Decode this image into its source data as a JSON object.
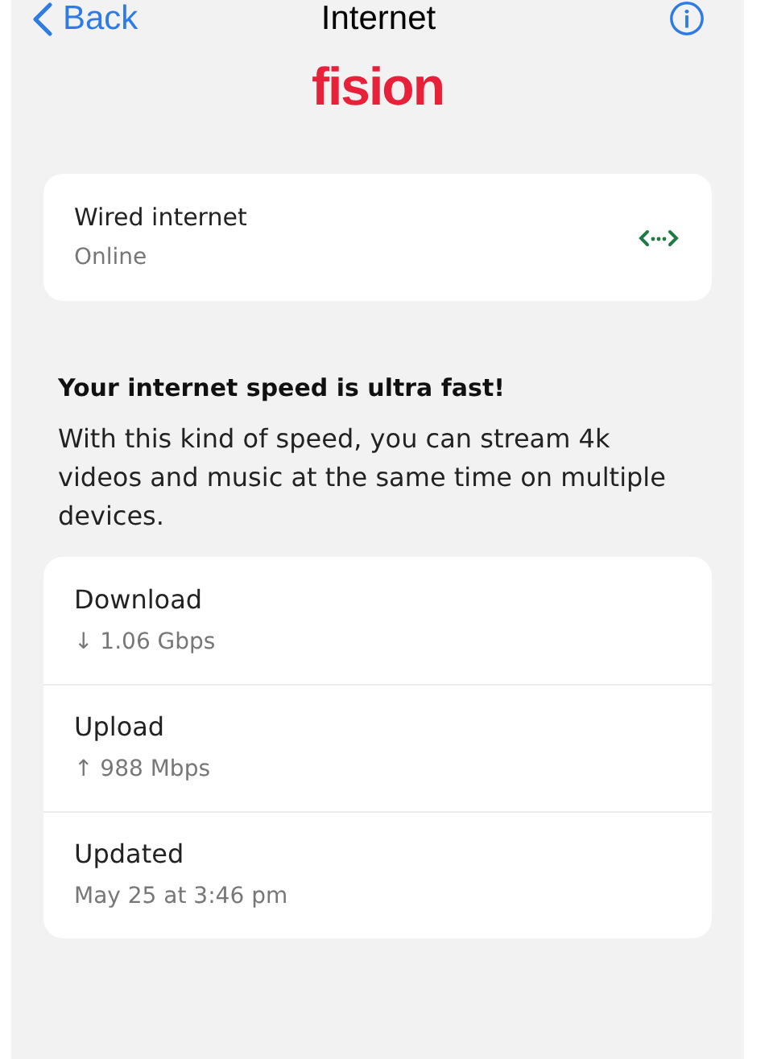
{
  "nav": {
    "back": "Back",
    "title": "Internet"
  },
  "logo": "fision",
  "connection": {
    "label": "Wired internet",
    "status": "Online"
  },
  "speed_summary": {
    "heading": "Your internet speed is ultra fast!",
    "body": "With this kind of speed, you can stream 4k videos and music at the same time on multiple devices."
  },
  "details": [
    {
      "label": "Download",
      "value": "↓ 1.06 Gbps"
    },
    {
      "label": "Upload",
      "value": "↑ 988 Mbps"
    },
    {
      "label": "Updated",
      "value": "May 25 at 3:46 pm"
    }
  ]
}
